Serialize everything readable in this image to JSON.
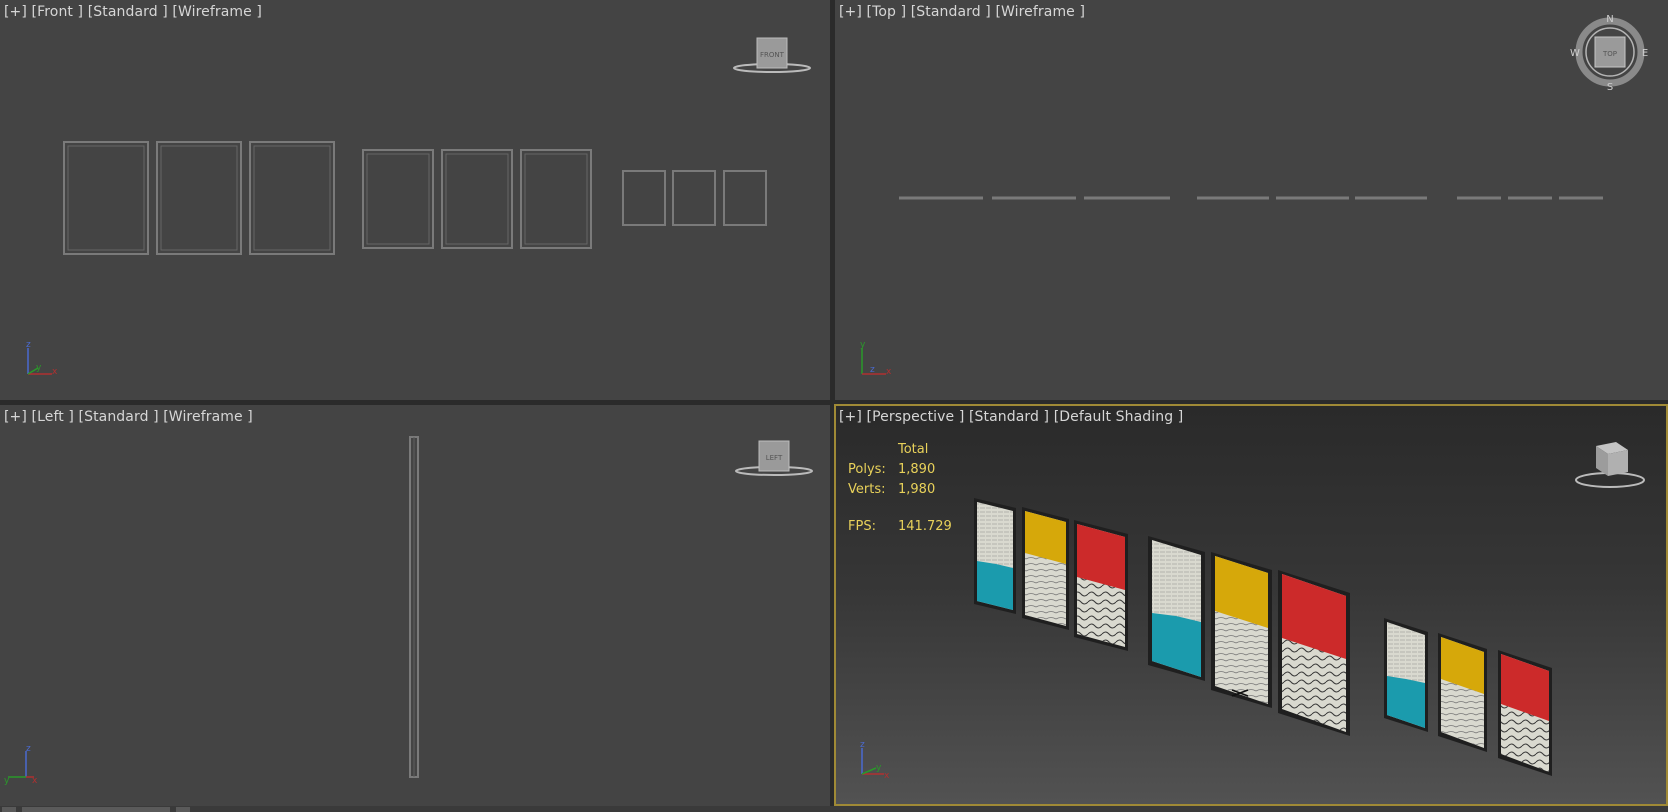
{
  "viewports": {
    "front": {
      "plus": "[+]",
      "view": "[Front ]",
      "mode": "[Standard ]",
      "shading": "[Wireframe ]",
      "cube_label": "FRONT"
    },
    "top": {
      "plus": "[+]",
      "view": "[Top ]",
      "mode": "[Standard ]",
      "shading": "[Wireframe ]",
      "cube_label": "TOP",
      "compass": {
        "n": "N",
        "s": "S",
        "e": "E",
        "w": "W"
      }
    },
    "left": {
      "plus": "[+]",
      "view": "[Left ]",
      "mode": "[Standard ]",
      "shading": "[Wireframe ]",
      "cube_label": "LEFT"
    },
    "perspective": {
      "plus": "[+]",
      "view": "[Perspective ]",
      "mode": "[Standard ]",
      "shading": "[Default Shading ]"
    }
  },
  "stats": {
    "total_header": "Total",
    "polys_label": "Polys:",
    "polys": "1,890",
    "verts_label": "Verts:",
    "verts": "1,980",
    "fps_label": "FPS:",
    "fps": "141.729"
  },
  "axis": {
    "x": "x",
    "y": "y",
    "z": "z"
  },
  "colors": {
    "viewport_bg": "#444444",
    "active_border": "#a08a36",
    "stats_text": "#e8d15a",
    "print_cyan": "#1b9bad",
    "print_yellow": "#d6a80a",
    "print_red": "#cc2a2a",
    "print_paper": "#d9d9cf"
  }
}
